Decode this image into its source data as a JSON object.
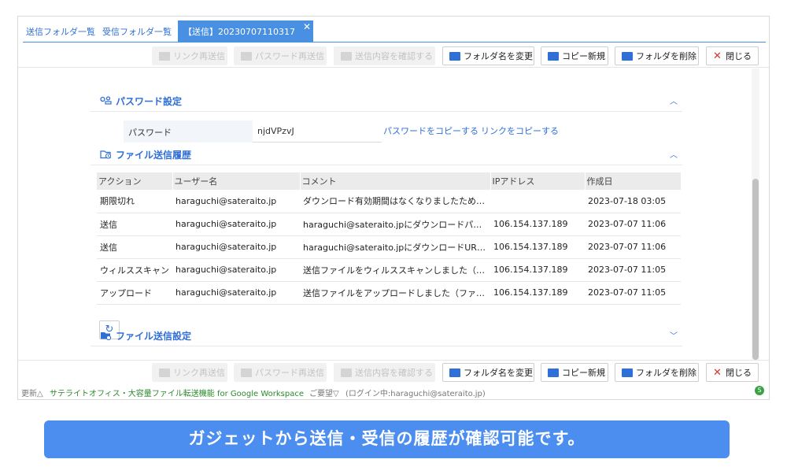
{
  "tabs": [
    {
      "label": "送信フォルダ一覧"
    },
    {
      "label": "受信フォルダ一覧"
    },
    {
      "label": "【送信】20230707110317",
      "close": "✕"
    }
  ],
  "toolbar": {
    "resend_link": "リンク再送信",
    "resend_password": "パスワード再送信",
    "confirm_content": "送信内容を確認する",
    "rename_folder": "フォルダ名を変更",
    "copy_new": "コピー新規",
    "delete_folder": "フォルダを削除",
    "close": "閉じる"
  },
  "password_section": {
    "title": "パスワード設定",
    "label": "パスワード",
    "value": "njdVPzvJ",
    "copy_password": "パスワードをコピーする",
    "copy_link": "リンクをコピーする"
  },
  "history_section": {
    "title": "ファイル送信履歴",
    "columns": [
      "アクション",
      "ユーザー名",
      "コメント",
      "IPアドレス",
      "作成日"
    ],
    "rows": [
      {
        "action": "期限切れ",
        "user": "haraguchi@sateraito.jp",
        "comment": "ダウンロード有効期間はなくなりましたため、フォ…",
        "ip": "",
        "date": "2023-07-18 03:05"
      },
      {
        "action": "送信",
        "user": "haraguchi@sateraito.jp",
        "comment": "haraguchi@sateraito.jpにダウンロードパスワー…",
        "ip": "106.154.137.189",
        "date": "2023-07-07 11:06"
      },
      {
        "action": "送信",
        "user": "haraguchi@sateraito.jp",
        "comment": "haraguchi@sateraito.jpにダウンロードURLを送…",
        "ip": "106.154.137.189",
        "date": "2023-07-07 11:06"
      },
      {
        "action": "ウィルススキャン",
        "user": "haraguchi@sateraito.jp",
        "comment": "送信ファイルをウィルススキャンしました（ファイ…",
        "ip": "106.154.137.189",
        "date": "2023-07-07 11:05"
      },
      {
        "action": "アップロード",
        "user": "haraguchi@sateraito.jp",
        "comment": "送信ファイルをアップロードしました（ファイル名…",
        "ip": "106.154.137.189",
        "date": "2023-07-07 11:05"
      }
    ]
  },
  "settings_section": {
    "title": "ファイル送信設定"
  },
  "statusbar": {
    "update": "更新△",
    "app_name": "サテライトオフィス・大容量ファイル転送機能 for Google Workspace",
    "request": "ご要望▽",
    "login": "(ログイン中:haraguchi@sateraito.jp)"
  },
  "banner": "ガジェットから送信・受信の履歴が確認可能です。",
  "colors": {
    "accent": "#2f6fd6",
    "tab_active": "#4a90e2",
    "banner": "#4b8ef0",
    "danger": "#d9342b"
  }
}
